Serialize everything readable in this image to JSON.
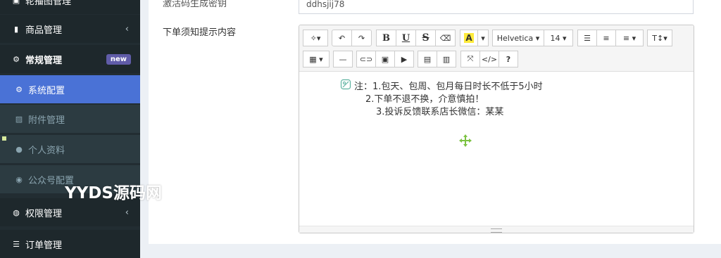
{
  "sidebar": {
    "items": [
      {
        "label": "轮播图管理",
        "icon": "image-icon"
      },
      {
        "label": "商品管理",
        "icon": "book-icon",
        "arrow": "‹"
      },
      {
        "label": "常规管理",
        "icon": "cogs-icon",
        "badge": "new"
      },
      {
        "label": "系统配置",
        "icon": "gear-icon"
      },
      {
        "label": "附件管理",
        "icon": "file-image-icon"
      },
      {
        "label": "个人资料",
        "icon": "user-icon"
      },
      {
        "label": "公众号配置",
        "icon": "wechat-icon"
      },
      {
        "label": "权限管理",
        "icon": "group-icon",
        "arrow": "‹"
      },
      {
        "label": "订单管理",
        "icon": "list-icon"
      }
    ]
  },
  "form": {
    "field1_label": "激活码生成密钥",
    "field1_value": "ddhsjij78",
    "field2_label": "下单须知提示内容"
  },
  "editor": {
    "toolbar": {
      "magic": "✧▾",
      "undo": "↶",
      "redo": "↷",
      "bold": "B",
      "underline": "U",
      "strike": "S",
      "eraser": "⌫",
      "color_a": "A",
      "caret": "▾",
      "font_name": "Helvetica ▾",
      "font_size": "14 ▾",
      "ul": "☰",
      "ol": "≡",
      "align": "≡ ▾",
      "height": "T↕▾",
      "table": "▦ ▾",
      "hr": "—",
      "link": "⊂⊃",
      "picture": "▣",
      "video": "▶",
      "doc1": "▤",
      "doc2": "▥",
      "fullscreen": "⤧",
      "code": "</>",
      "help": "?"
    },
    "content": {
      "line1": "注：1.包天、包周、包月每日时长不低于5小时",
      "line2": "2.下单不退不换，介意慎拍！",
      "line3": "3.投诉反馈联系店长微信：某某"
    }
  },
  "watermark": "YYDS源码网",
  "colors": {
    "sidebar_bg": "#222d32",
    "active_item": "#4a72d6",
    "badge_new": "#605ca8",
    "move_cross": "#7cc242"
  }
}
